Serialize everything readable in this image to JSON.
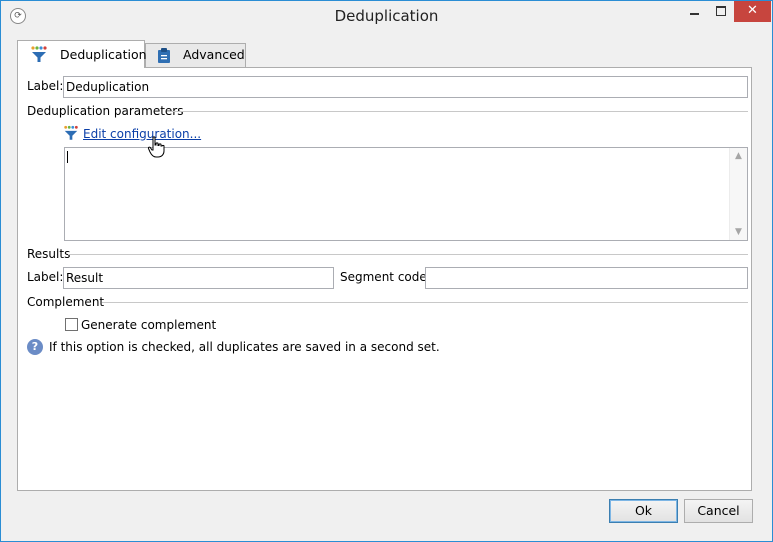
{
  "window": {
    "title": "Deduplication",
    "app_icon": "app-logo-icon",
    "controls": {
      "minimize": "minimize-icon",
      "maximize": "maximize-icon",
      "close": "✕"
    }
  },
  "tabs": [
    {
      "label": "Deduplication",
      "icon": "deduplication-funnel-icon",
      "active": true
    },
    {
      "label": "Advanced",
      "icon": "clipboard-icon",
      "active": false
    }
  ],
  "form": {
    "label_caption": "Label:",
    "label_value": "Deduplication",
    "dedup_section": "Deduplication parameters",
    "edit_link": "Edit configuration...",
    "results_section": "Results",
    "result_label_caption": "Label:",
    "result_label_value": "Result",
    "segment_code_caption": "Segment code:",
    "segment_code_value": "",
    "complement_section": "Complement",
    "generate_complement_label": "Generate complement",
    "generate_complement_checked": false,
    "help_text": "If this option is checked, all duplicates are saved in a second set."
  },
  "buttons": {
    "ok": "Ok",
    "cancel": "Cancel"
  },
  "colors": {
    "close_button": "#c7453e",
    "link": "#0b3fa8",
    "window_border": "#2a8dd4",
    "help_icon": "#6b8cc6"
  }
}
